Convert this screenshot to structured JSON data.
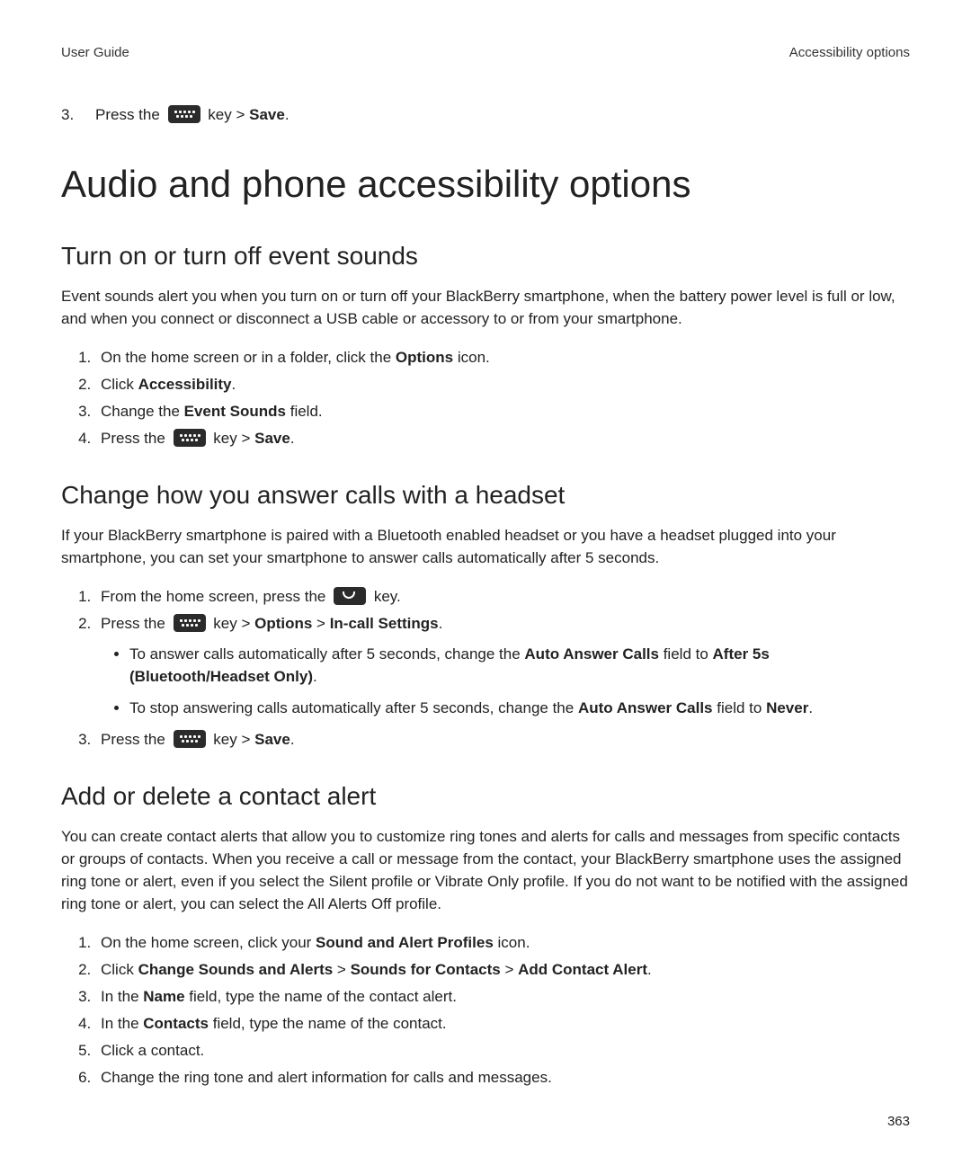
{
  "header": {
    "left": "User Guide",
    "right": "Accessibility options"
  },
  "topStep": {
    "num": "3.",
    "pre": "Press the ",
    "mid": " key > ",
    "save": "Save",
    "end": "."
  },
  "h1": "Audio and phone accessibility options",
  "sectionA": {
    "heading": "Turn on or turn off event sounds",
    "para": "Event sounds alert you when you turn on or turn off your BlackBerry smartphone, when the battery power level is full or low, and when you connect or disconnect a USB cable or accessory to or from your smartphone.",
    "step1_a": "On the home screen or in a folder, click the ",
    "step1_b": "Options",
    "step1_c": " icon.",
    "step2_a": "Click ",
    "step2_b": "Accessibility",
    "step2_c": ".",
    "step3_a": "Change the ",
    "step3_b": "Event Sounds",
    "step3_c": " field.",
    "step4_a": "Press the ",
    "step4_b": " key > ",
    "step4_c": "Save",
    "step4_d": "."
  },
  "sectionB": {
    "heading": "Change how you answer calls with a headset",
    "para": "If your BlackBerry smartphone is paired with a Bluetooth enabled headset or you have a headset plugged into your smartphone, you can set your smartphone to answer calls automatically after 5 seconds.",
    "step1_a": "From the home screen, press the ",
    "step1_b": " key.",
    "step2_a": "Press the ",
    "step2_b": " key > ",
    "step2_c": "Options",
    "step2_d": " > ",
    "step2_e": "In-call Settings",
    "step2_f": ".",
    "bullet1_a": "To answer calls automatically after 5 seconds, change the ",
    "bullet1_b": "Auto Answer Calls",
    "bullet1_c": " field to ",
    "bullet1_d": "After 5s (Bluetooth/Headset Only)",
    "bullet1_e": ".",
    "bullet2_a": "To stop answering calls automatically after 5 seconds, change the ",
    "bullet2_b": "Auto Answer Calls",
    "bullet2_c": " field to ",
    "bullet2_d": "Never",
    "bullet2_e": ".",
    "step3_a": "Press the ",
    "step3_b": " key > ",
    "step3_c": "Save",
    "step3_d": "."
  },
  "sectionC": {
    "heading": "Add or delete a contact alert",
    "para": "You can create contact alerts that allow you to customize ring tones and alerts for calls and messages from specific contacts or groups of contacts. When you receive a call or message from the contact, your BlackBerry smartphone uses the assigned ring tone or alert, even if you select the Silent profile or Vibrate Only profile. If you do not want to be notified with the assigned ring tone or alert, you can select the All Alerts Off profile.",
    "step1_a": "On the home screen, click your ",
    "step1_b": "Sound and Alert Profiles",
    "step1_c": " icon.",
    "step2_a": "Click ",
    "step2_b": "Change Sounds and Alerts",
    "step2_c": " > ",
    "step2_d": "Sounds for Contacts",
    "step2_e": " > ",
    "step2_f": "Add Contact Alert",
    "step2_g": ".",
    "step3_a": "In the ",
    "step3_b": "Name",
    "step3_c": " field, type the name of the contact alert.",
    "step4_a": "In the ",
    "step4_b": "Contacts",
    "step4_c": " field, type the name of the contact.",
    "step5": "Click a contact.",
    "step6": "Change the ring tone and alert information for calls and messages."
  },
  "pageNumber": "363"
}
